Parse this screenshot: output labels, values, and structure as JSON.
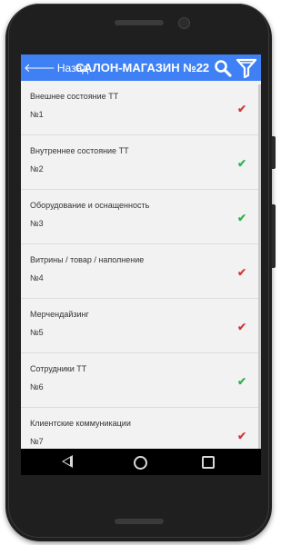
{
  "appbar": {
    "back_label": "Назад",
    "title": "САЛОН-МАГАЗИН №22",
    "color": "#3f81f5"
  },
  "icons": {
    "search": "search-icon",
    "filter": "filter-icon"
  },
  "items": [
    {
      "title": "Внешнее состояние ТТ",
      "number": "№1",
      "check": "✔",
      "status": "red"
    },
    {
      "title": "Внутреннее состояние ТТ",
      "number": "№2",
      "check": "✔",
      "status": "green"
    },
    {
      "title": "Оборудование и оснащенность",
      "number": "№3",
      "check": "✔",
      "status": "green"
    },
    {
      "title": "Витрины / товар / наполнение",
      "number": "№4",
      "check": "✔",
      "status": "red"
    },
    {
      "title": "Мерчендайзинг",
      "number": "№5",
      "check": "✔",
      "status": "red"
    },
    {
      "title": "Сотрудники ТТ",
      "number": "№6",
      "check": "✔",
      "status": "green"
    },
    {
      "title": "Клиентские коммуникации",
      "number": "№7",
      "check": "✔",
      "status": "red"
    }
  ],
  "status_colors": {
    "red": "#d23b3b",
    "green": "#2fb34a"
  }
}
